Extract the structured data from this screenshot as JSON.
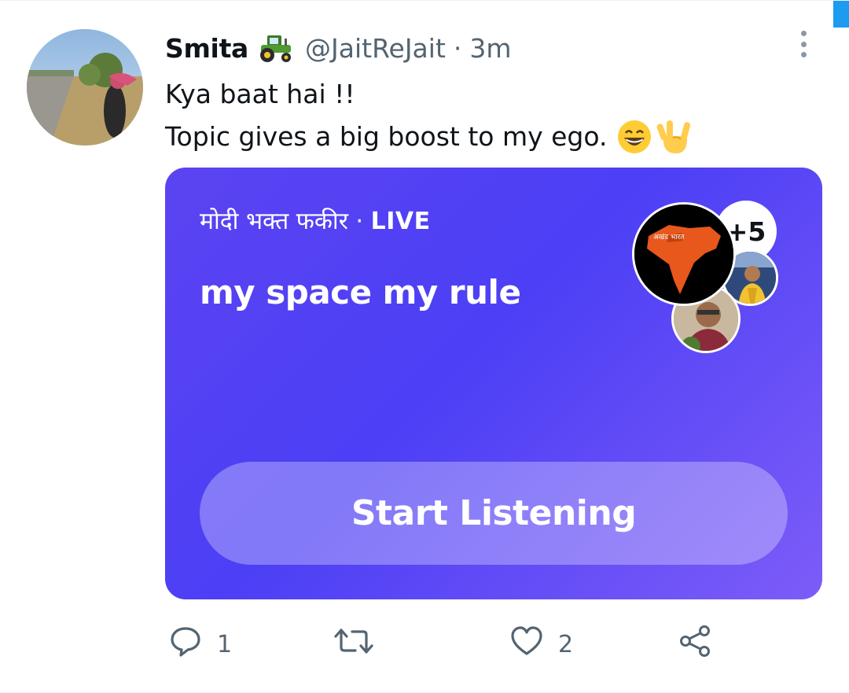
{
  "tweet": {
    "author_name": "Smita",
    "author_handle": "@JaitReJait",
    "separator": "·",
    "timestamp": "3m",
    "text_line1": "Kya baat hai !!",
    "text_line2": "Topic gives a big boost to my ego.",
    "icons": {
      "name_badge": "tractor-emoji",
      "text_emojis": [
        "grinning-face-emoji",
        "love-you-gesture-emoji"
      ],
      "more": "more-options-icon"
    }
  },
  "space": {
    "host_name": "मोदी भक्त फकीर",
    "separator": "·",
    "status": "LIVE",
    "title": "my space my rule",
    "extra_participants": "+5",
    "participant_avatar_map_text": "अखंड भारत",
    "button_label": "Start Listening",
    "colors": {
      "gradient_start": "#5b44f2",
      "gradient_end": "#7d5cf8"
    }
  },
  "actions": {
    "reply_count": "1",
    "retweet_count": "",
    "like_count": "2",
    "icons": [
      "reply-icon",
      "retweet-icon",
      "like-icon",
      "share-icon"
    ]
  },
  "colors": {
    "text_primary": "#0f1419",
    "text_secondary": "#536471",
    "accent": "#1d9bf0"
  }
}
